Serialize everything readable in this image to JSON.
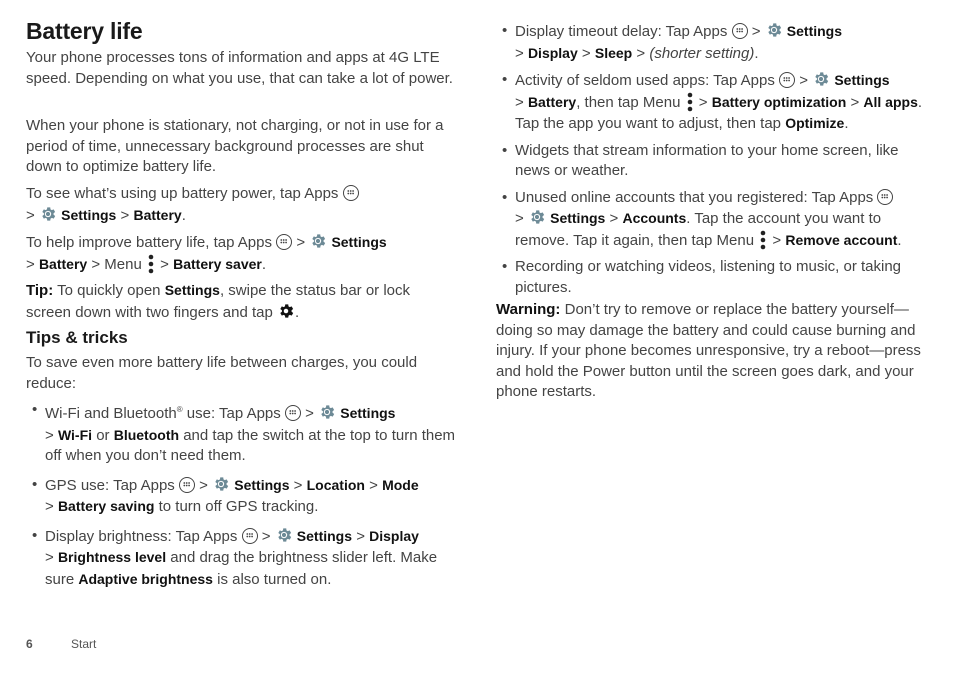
{
  "title": "Battery life",
  "left": {
    "intro1": "Your phone processes tons of information and apps at 4G LTE speed. Depending on what you use, that can take a lot of power.",
    "intro2": "When your phone is stationary, not charging, or not in use for a period of time, unnecessary background processes are shut down to optimize battery life.",
    "see_usage": {
      "pre": "To see what’s using up battery power, tap Apps",
      "settings": "Settings",
      "battery": "Battery"
    },
    "improve": {
      "pre": "To help improve battery life, tap Apps",
      "settings": "Settings",
      "battery": "Battery",
      "menu": "Menu",
      "saver": "Battery saver"
    },
    "tip": {
      "label": "Tip:",
      "pre": "To quickly open",
      "settings": "Settings",
      "post": ", swipe the status bar or lock screen down with two fingers and tap"
    },
    "tips_heading": "Tips & tricks",
    "tips_intro": "To save even more battery life between charges, you could reduce:",
    "bullets": [
      {
        "pre": "Wi-Fi and Bluetooth",
        "reg": "®",
        "mid": " use: Tap Apps",
        "settings": "Settings",
        "b1": "Wi-Fi",
        "or": "or",
        "b2": "Bluetooth",
        "post": "and tap the switch at the top to turn them off when you don’t need them."
      },
      {
        "pre": "GPS use: Tap Apps",
        "settings": "Settings",
        "b1": "Location",
        "b2": "Mode",
        "b3": "Battery saving",
        "post": "to turn off GPS tracking."
      },
      {
        "pre": "Display brightness: Tap Apps",
        "settings": "Settings",
        "b1": "Display",
        "b2": "Brightness level",
        "mid": "and drag the brightness slider left. Make sure",
        "b3": "Adaptive brightness",
        "post": "is also turned on."
      }
    ]
  },
  "right": {
    "bullets": [
      {
        "pre": "Display timeout delay: Tap Apps",
        "settings": "Settings",
        "b1": "Display",
        "b2": "Sleep",
        "italic": "(shorter setting)"
      },
      {
        "pre": "Activity of seldom used apps: Tap Apps",
        "settings": "Settings",
        "b1": "Battery",
        "mid": ", then tap Menu",
        "b2": "Battery optimization",
        "b3": "All apps",
        "mid2": ". Tap the app you want to adjust, then tap",
        "b4": "Optimize"
      },
      {
        "text": "Widgets that stream information to your home screen, like news or weather."
      },
      {
        "pre": "Unused online accounts that you registered: Tap Apps",
        "settings": "Settings",
        "b1": "Accounts",
        "mid": ". Tap the account you want to remove. Tap it again, then tap Menu",
        "b2": "Remove account"
      },
      {
        "text": "Recording or watching videos, listening to music, or taking pictures."
      }
    ],
    "warning": {
      "label": "Warning:",
      "text": "Don’t try to remove or replace the battery yourself—doing so may damage the battery and could cause burning and injury. If your phone becomes unresponsive, try a reboot—press and hold the Power button until the screen goes dark, and your phone restarts."
    }
  },
  "footer": {
    "page_number": "6",
    "section": "Start"
  },
  "colors": {
    "text": "#444444",
    "bold": "#111111",
    "gear": "#6d8a96"
  }
}
